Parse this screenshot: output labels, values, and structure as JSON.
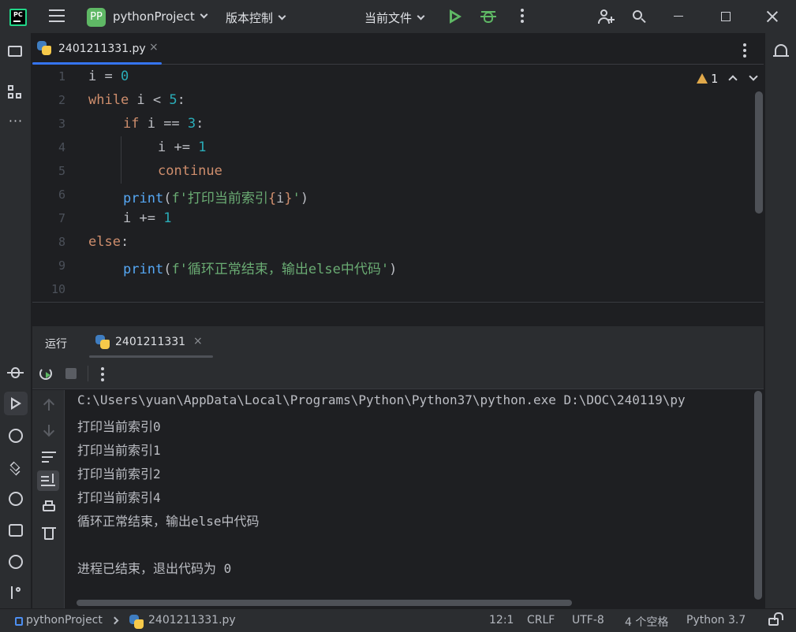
{
  "titlebar": {
    "project_badge": "PP",
    "project_name": "pythonProject",
    "vcs_label": "版本控制",
    "run_config": "当前文件"
  },
  "editor": {
    "tab_label": "2401211331.py",
    "tab_close": "×",
    "warning_count": "1",
    "line_numbers": [
      "1",
      "2",
      "3",
      "4",
      "5",
      "6",
      "7",
      "8",
      "9",
      "10"
    ]
  },
  "code": {
    "l1_var": "i",
    "l1_op": " = ",
    "l1_num": "0",
    "l2_kw": "while",
    "l2_mid": " i < ",
    "l2_num": "5",
    "l2_end": ":",
    "l3_kw": "if",
    "l3_mid": " i == ",
    "l3_num": "3",
    "l3_end": ":",
    "l4_mid": "i += ",
    "l4_num": "1",
    "l5_kw": "continue",
    "l6_fn": "print",
    "l6_open": "(",
    "l6_str1": "f'打印当前索引",
    "l6_brace_open": "{",
    "l6_var": "i",
    "l6_brace_close": "}",
    "l6_str2": "'",
    "l6_close": ")",
    "l7_mid": "i += ",
    "l7_num": "1",
    "l8_kw": "else",
    "l8_end": ":",
    "l9_fn": "print",
    "l9_open": "(",
    "l9_str": "f'循环正常结束，输出else中代码'",
    "l9_close": ")"
  },
  "run_panel": {
    "title": "运行",
    "tab_label": "2401211331",
    "tab_close": "×",
    "console_lines": [
      "C:\\Users\\yuan\\AppData\\Local\\Programs\\Python\\Python37\\python.exe D:\\DOC\\240119\\py",
      "打印当前索引0",
      "打印当前索引1",
      "打印当前索引2",
      "打印当前索引4",
      "循环正常结束，输出else中代码",
      "",
      "进程已结束，退出代码为 0"
    ]
  },
  "statusbar": {
    "project": "pythonProject",
    "file": "2401211331.py",
    "position": "12:1",
    "line_sep": "CRLF",
    "encoding": "UTF-8",
    "indent": "4 个空格",
    "interpreter": "Python 3.7"
  },
  "colors": {
    "accent": "#3574f0",
    "run_green": "#5fb865",
    "keyword": "#cf8e6d",
    "number": "#2aacb8",
    "string": "#6aab73",
    "function": "#56a8f5"
  }
}
